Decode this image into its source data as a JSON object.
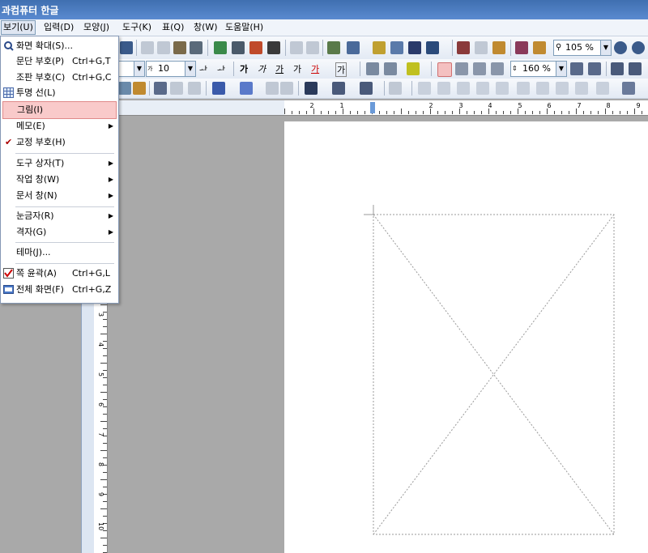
{
  "app": {
    "title": "과컴퓨터 한글"
  },
  "menubar": {
    "items": [
      {
        "label": "보기(U)"
      },
      {
        "label": "입력(D)"
      },
      {
        "label": "모양(J)"
      },
      {
        "label": "도구(K)"
      },
      {
        "label": "표(Q)"
      },
      {
        "label": "창(W)"
      },
      {
        "label": "도움말(H)"
      }
    ]
  },
  "toolbar": {
    "zoom_value": "105 %",
    "font_size": "10",
    "line_spacing": "160 %",
    "text_buttons": [
      "가",
      "가",
      "가",
      "가",
      "가",
      "가"
    ]
  },
  "view_menu": {
    "items": [
      {
        "label": "화면 확대(S)...",
        "shortcut": "",
        "icon": "zoom-icon"
      },
      {
        "label": "문단 부호(P)",
        "shortcut": "Ctrl+G,T"
      },
      {
        "label": "조판 부호(C)",
        "shortcut": "Ctrl+G,C"
      },
      {
        "label": "투명 선(L)",
        "shortcut": "",
        "icon": "grid-icon"
      },
      {
        "label": "그림(I)",
        "shortcut": "",
        "highlighted": true
      },
      {
        "label": "메모(E)",
        "submenu": true
      },
      {
        "label": "교정 부호(H)",
        "checked": true
      },
      {
        "label": "도구 상자(T)",
        "submenu": true
      },
      {
        "label": "작업 창(W)",
        "submenu": true
      },
      {
        "label": "문서 창(N)",
        "submenu": true
      },
      {
        "label": "눈금자(R)",
        "submenu": true
      },
      {
        "label": "격자(G)",
        "submenu": true
      },
      {
        "label": "테마(J)..."
      },
      {
        "label": "쪽 윤곽(A)",
        "shortcut": "Ctrl+G,L",
        "icon": "check-box-icon"
      },
      {
        "label": "전체 화면(F)",
        "shortcut": "Ctrl+G,Z",
        "icon": "fullscreen-icon"
      }
    ]
  },
  "ruler": {
    "h_labels": [
      "2",
      "1",
      "1",
      "2",
      "3",
      "4",
      "5",
      "6",
      "7",
      "8",
      "9"
    ],
    "v_labels": [
      "3",
      "4",
      "5",
      "6",
      "7",
      "8",
      "9",
      "10",
      "11"
    ]
  },
  "colors": {
    "highlight": "#f9caca",
    "titlebar": "#4a7cc0",
    "workspace": "#a9a9a9"
  }
}
